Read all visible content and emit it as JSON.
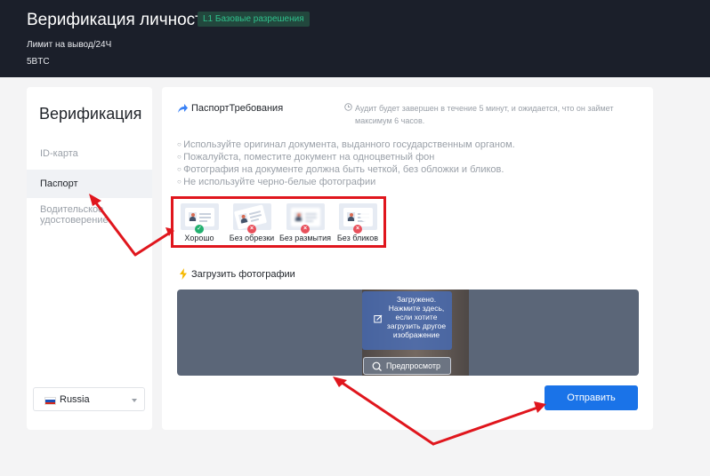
{
  "header": {
    "title": "Верификация личности",
    "level_badge": "L1 Базовые разрешения",
    "limit_label": "Лимит на вывод/24Ч",
    "limit_value": "5BTC"
  },
  "sidebar": {
    "title": "Верификация",
    "items": [
      {
        "label": "ID-карта",
        "active": false
      },
      {
        "label": "Паспорт",
        "active": true
      },
      {
        "label": "Водительское удостоверение",
        "active": false
      }
    ],
    "country": "Russia"
  },
  "main": {
    "passport_section_title": "ПаспортТребования",
    "audit_note": "Аудит будет завершен в течение 5 минут, и ожидается, что он займет максимум 6 часов.",
    "requirements": [
      "Используйте оригинал документа, выданного государственным органом.",
      "Пожалуйста, поместите документ на одноцветный фон",
      "Фотография на документе должна быть четкой, без обложки и бликов.",
      "Не используйте черно-белые фотографии"
    ],
    "samples": [
      {
        "label": "Хорошо",
        "status": "ok"
      },
      {
        "label": "Без обрезки",
        "status": "bad"
      },
      {
        "label": "Без размытия",
        "status": "bad"
      },
      {
        "label": "Без бликов",
        "status": "bad"
      }
    ],
    "upload_section_title": "Загрузить фотографии",
    "upload_overlay_text": "Загружено. Нажмите здесь, если хотите загрузить другое изображение",
    "preview_label": "Предпросмотр",
    "submit_label": "Отправить"
  },
  "colors": {
    "header_bg": "#1b1f2a",
    "badge_text": "#30c08c",
    "primary": "#1a73e8",
    "annotation_red": "#e0161d",
    "ok": "#22b06f",
    "bad": "#e8505b"
  }
}
